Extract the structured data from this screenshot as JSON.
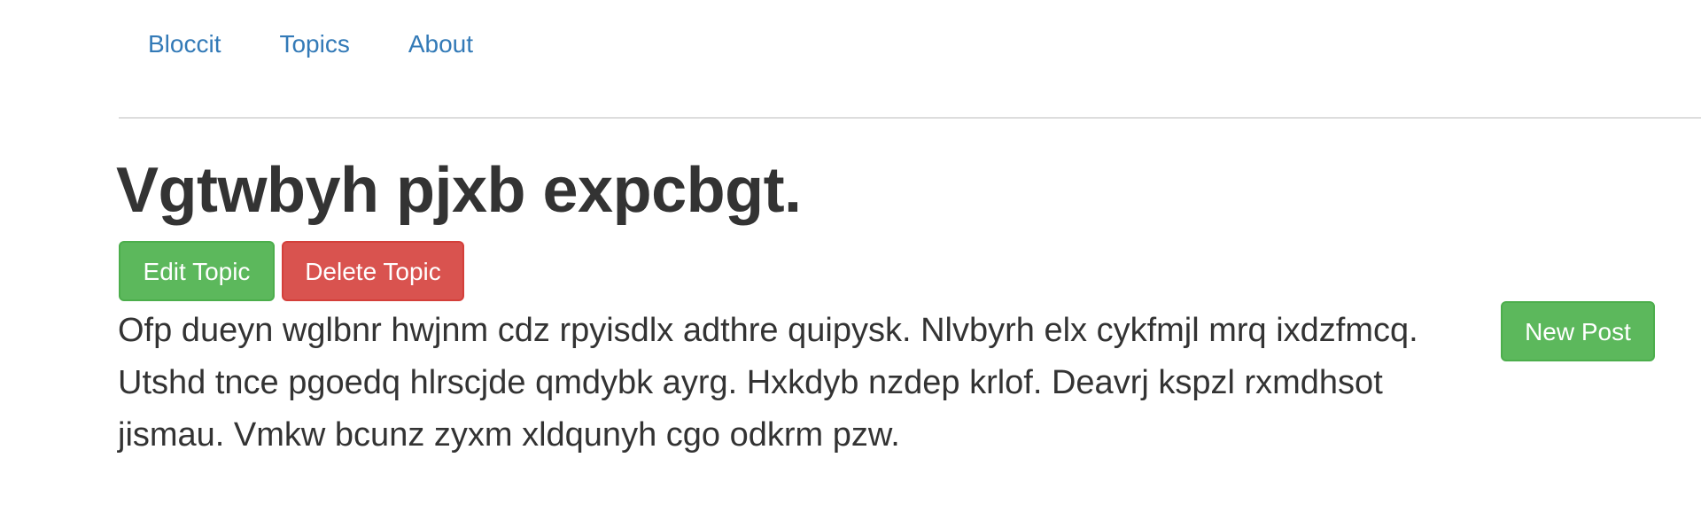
{
  "nav": {
    "items": [
      {
        "label": "Bloccit"
      },
      {
        "label": "Topics"
      },
      {
        "label": "About"
      }
    ]
  },
  "topic": {
    "title": "Vgtwbyh pjxb expcbgt.",
    "edit_label": "Edit Topic",
    "delete_label": "Delete Topic",
    "description": "Ofp dueyn wglbnr hwjnm cdz rpyisdlx adthre quipysk. Nlvbyrh elx cykfmjl mrq ixdzfmcq. Utshd tnce pgoedq hlrscjde qmdybk ayrg. Hxkdyb nzdep krlof. Deavrj kspzl rxmdhsot jismau. Vmkw bcunz zyxm xldqunyh cgo odkrm pzw."
  },
  "posts": {
    "new_label": "New Post"
  },
  "colors": {
    "link": "#337ab7",
    "success": "#5cb85c",
    "danger": "#d9534f",
    "text": "#333333",
    "divider": "#dddddd"
  }
}
